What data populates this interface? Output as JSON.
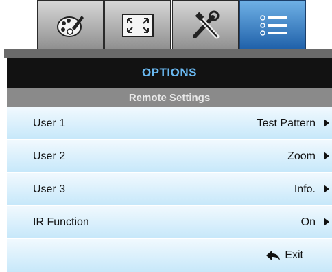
{
  "tabs": [
    {
      "icon": "palette-icon",
      "active": false
    },
    {
      "icon": "screen-resize-icon",
      "active": false
    },
    {
      "icon": "tools-icon",
      "active": false
    },
    {
      "icon": "menu-list-icon",
      "active": true
    }
  ],
  "header": {
    "title": "OPTIONS",
    "subtitle": "Remote Settings"
  },
  "rows": [
    {
      "label": "User 1",
      "value": "Test Pattern"
    },
    {
      "label": "User 2",
      "value": "Zoom"
    },
    {
      "label": "User 3",
      "value": "Info."
    },
    {
      "label": "IR Function",
      "value": "On"
    }
  ],
  "footer": {
    "exit_label": "Exit",
    "exit_icon": "back-arrow-icon"
  },
  "colors": {
    "title_text": "#69b8f0",
    "active_tab": "#3d86cf",
    "row_bg": "#d8eefb"
  }
}
